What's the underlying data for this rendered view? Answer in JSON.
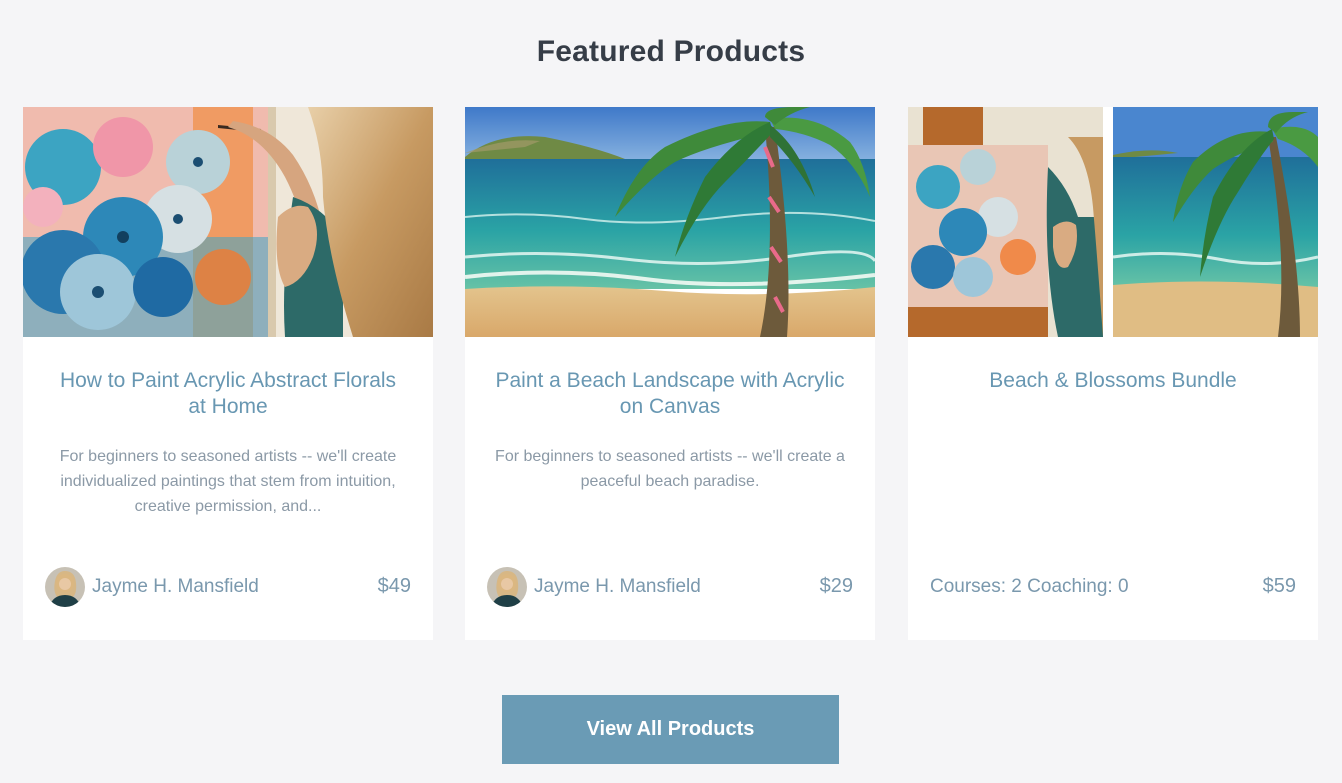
{
  "section": {
    "title": "Featured Products"
  },
  "products": [
    {
      "title": "How to Paint Acrylic Abstract Florals at Home",
      "description": "For beginners to seasoned artists -- we'll create individualized paintings that stem from intuition, creative permission, and...",
      "author": "Jayme H. Mansfield",
      "price": "$49",
      "thumbnail_icon": "abstract-florals-painting-image"
    },
    {
      "title": "Paint a Beach Landscape with Acrylic on Canvas",
      "description": "For beginners to seasoned artists -- we'll create a peaceful beach paradise.",
      "author": "Jayme H. Mansfield",
      "price": "$29",
      "thumbnail_icon": "beach-landscape-painting-image"
    },
    {
      "title": "Beach & Blossoms Bundle",
      "meta": "Courses: 2 Coaching: 0",
      "price": "$59",
      "thumbnail_icon": "bundle-collage-image"
    }
  ],
  "cta": {
    "label": "View All Products"
  },
  "colors": {
    "background": "#f5f5f7",
    "heading": "#363d47",
    "accent": "#6897b2",
    "button": "#6a9bb5",
    "muted_text": "#8b99a6"
  }
}
